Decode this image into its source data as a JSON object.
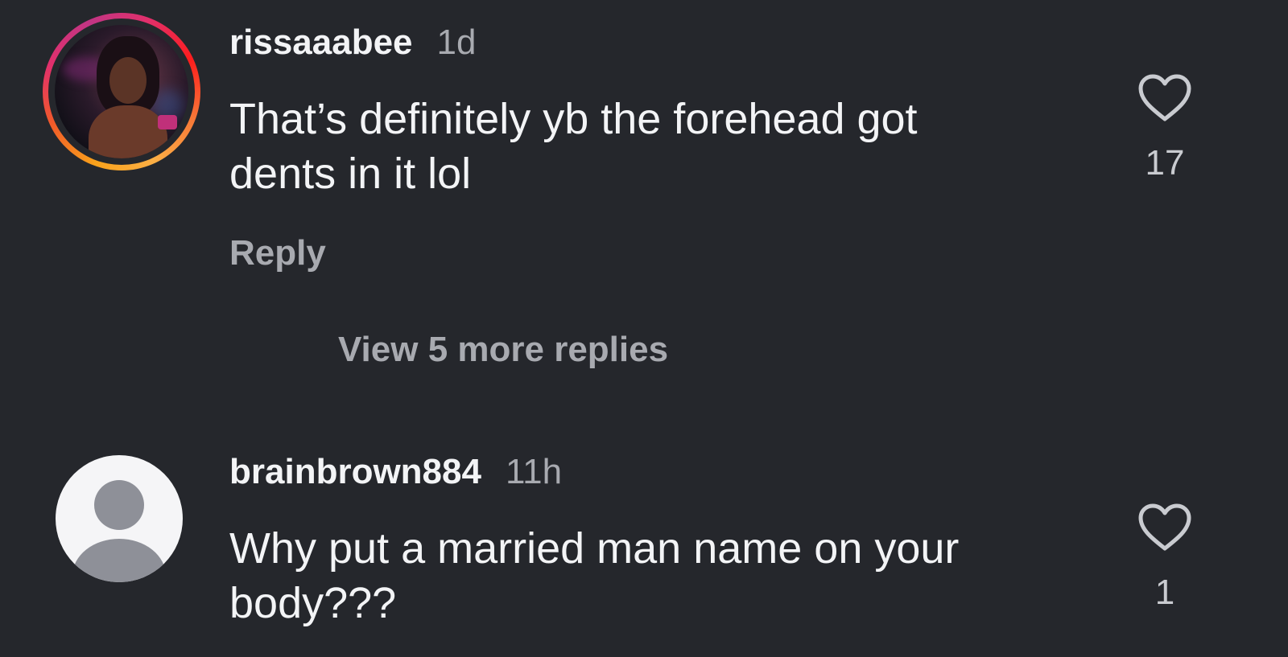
{
  "colors": {
    "background": "#25272c",
    "primary_text": "#f3f4f6",
    "secondary_text": "#a8aab0",
    "story_ring": [
      "#f9a21b",
      "#e1306c",
      "#c13584"
    ]
  },
  "comments": [
    {
      "username": "rissaaabee",
      "time": "1d",
      "text_line1": "That’s definitely yb the forehead got",
      "text_line2": "dents in it lol",
      "reply_label": "Reply",
      "like_count": "17",
      "avatar_icon": "profile-photo-with-story-ring"
    },
    {
      "username": "brainbrown884",
      "time": "11h",
      "text_line1": "Why put a married man name on your",
      "text_line2": "body???",
      "like_count": "1",
      "avatar_icon": "default-user-icon"
    }
  ],
  "view_more_replies": "View 5 more replies",
  "icons": {
    "like": "heart-outline-icon"
  }
}
